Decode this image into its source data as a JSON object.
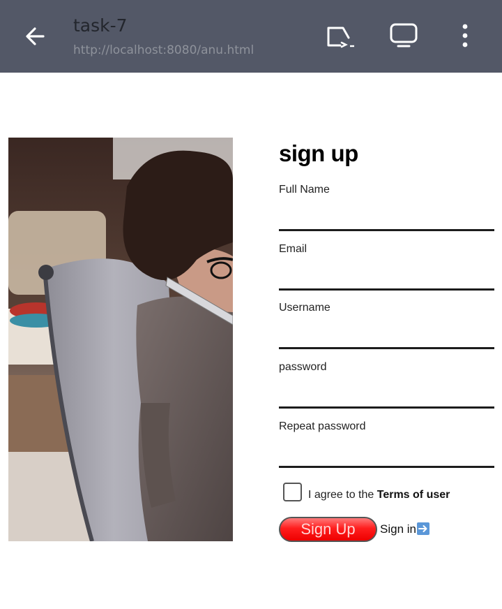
{
  "browser": {
    "title": "task-7",
    "url": "http://localhost:8080/anu.html",
    "icons": {
      "back": "arrow-left-icon",
      "cast": "cast-icon",
      "tv": "tv-icon",
      "menu": "more-vertical-icon"
    },
    "bar_color": "#535867"
  },
  "form": {
    "title": "sign up",
    "fields": [
      {
        "label": "Full Name",
        "value": "",
        "placeholder": ""
      },
      {
        "label": "Email",
        "value": "",
        "placeholder": ""
      },
      {
        "label": "Username",
        "value": "",
        "placeholder": ""
      },
      {
        "label": "password",
        "value": "",
        "placeholder": ""
      },
      {
        "label": "Repeat password",
        "value": "",
        "placeholder": ""
      }
    ],
    "agree_prefix": "I agree to the ",
    "terms_label": "Terms of user",
    "agree_checked": false,
    "signup_label": "Sign Up",
    "signin_label": "Sign in",
    "signin_icon": "right-arrow-emoji-icon",
    "accent_color": "#ff1e1e"
  }
}
